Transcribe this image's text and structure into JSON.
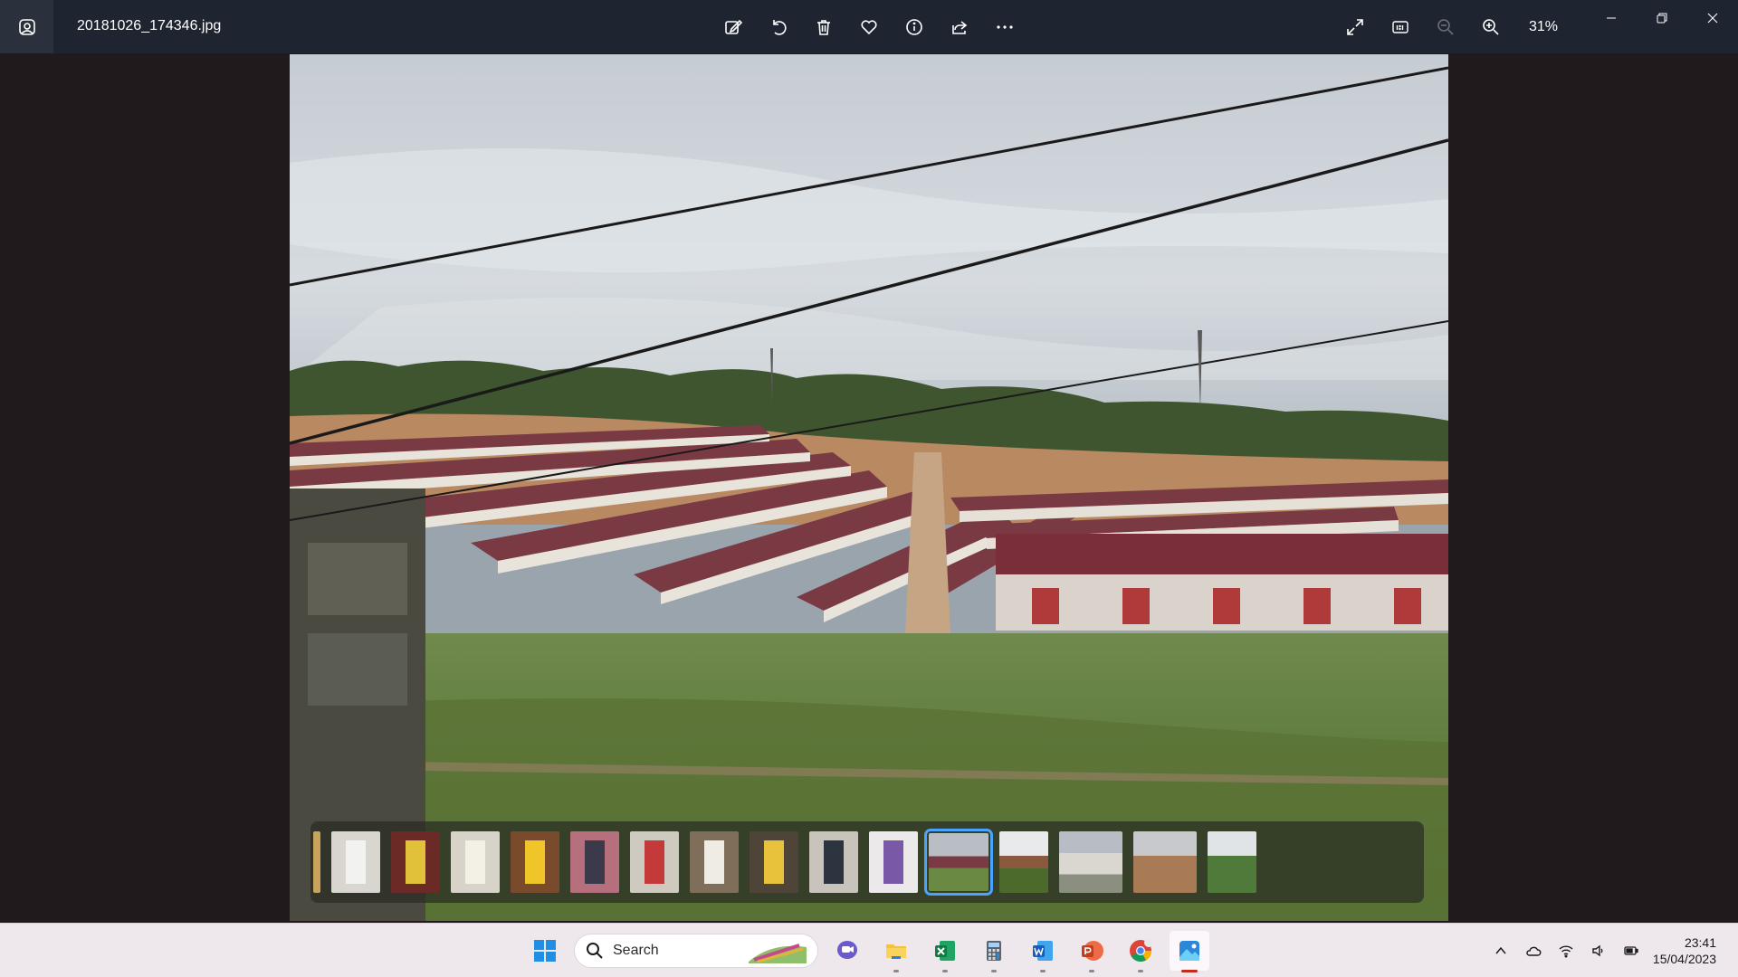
{
  "window": {
    "file_name": "20181026_174346.jpg",
    "zoom": "31%"
  },
  "toolbar": {
    "left_icon": "photos-app-icon",
    "center_icons": [
      "edit-image-icon",
      "rotate-icon",
      "delete-icon",
      "favorite-icon",
      "info-icon",
      "share-icon",
      "more-icon"
    ],
    "right_icons": [
      "full-screen-icon",
      "actual-size-icon",
      "zoom-out-icon",
      "zoom-in-icon"
    ],
    "window_controls": [
      "minimize-icon",
      "restore-icon",
      "close-icon"
    ]
  },
  "photo": {
    "subject": "housing-development-landscape"
  },
  "filmstrip": {
    "selected_index": 11,
    "thumbnail_count": 16
  },
  "taskbar": {
    "search_placeholder": "Search",
    "apps": [
      "start-icon",
      "search-box",
      "teams-chat-icon",
      "file-explorer-icon",
      "excel-icon",
      "calculator-icon",
      "word-icon",
      "powerpoint-icon",
      "chrome-icon",
      "photos-icon"
    ],
    "clock_time": "23:41",
    "clock_date": "15/04/2023"
  },
  "colors": {
    "titlebar": "#1e2530",
    "accent": "#4aa3ff",
    "taskbar": "#eee8ec",
    "active_indicator": "#c42b1c"
  }
}
